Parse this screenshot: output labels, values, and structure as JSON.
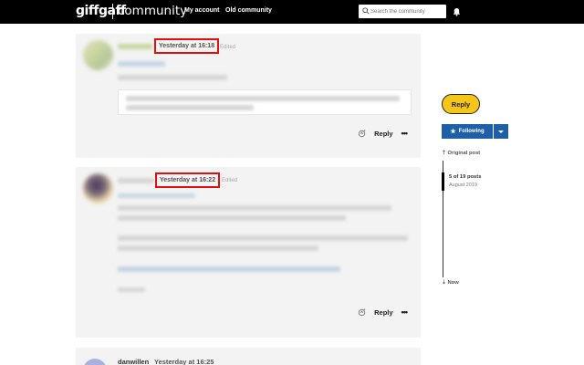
{
  "header": {
    "logo": "giffgaff",
    "brand": "community",
    "nav": {
      "my_account": "My account",
      "old_community": "Old community"
    },
    "search": {
      "placeholder": "Search the community",
      "icon": "search-icon"
    },
    "notifications_icon": "bell-icon"
  },
  "posts": [
    {
      "timestamp": "Yesterday at 16:18",
      "edited": "Edited",
      "actions": {
        "reply": "Reply",
        "more": "•••",
        "kudos_icon": "kudos-icon"
      }
    },
    {
      "timestamp": "Yesterday at 16:22",
      "edited": "Edited",
      "actions": {
        "reply": "Reply",
        "more": "•••",
        "kudos_icon": "kudos-icon"
      }
    },
    {
      "username": "danwillen",
      "timestamp": "Yesterday at 16:25"
    }
  ],
  "sidebar": {
    "reply_button": "Reply",
    "following_button": "Following",
    "original_post": "Original post",
    "position": "5 of 19 posts",
    "position_date": "August 2019",
    "now": "Now"
  },
  "colors": {
    "topbar": "#000000",
    "accent_yellow": "#f5c518",
    "following_blue": "#1d5fa8",
    "highlight_red": "#e01010"
  }
}
